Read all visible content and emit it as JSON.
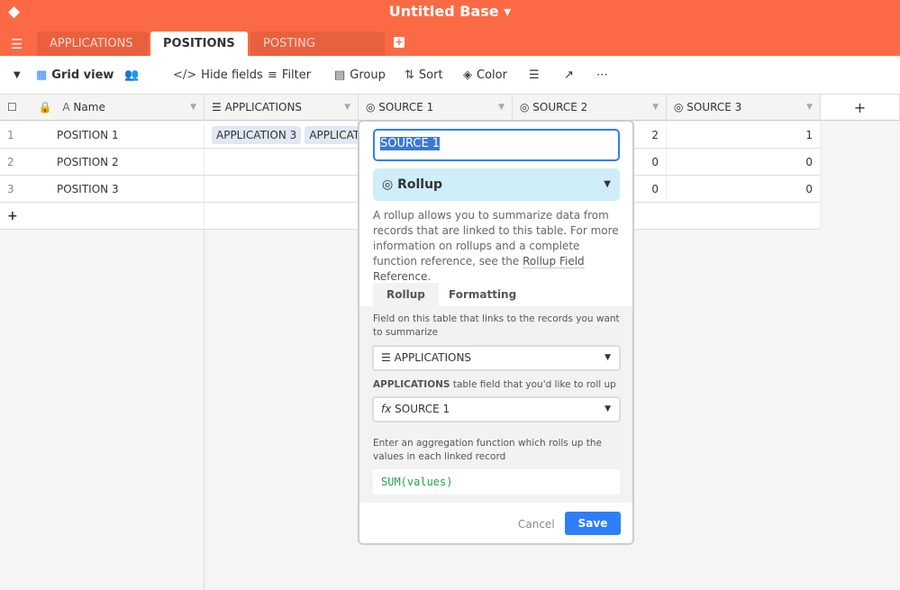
{
  "app": {
    "title": "Untitled Base ▾"
  },
  "tabs": [
    {
      "label": "APPLICATIONS"
    },
    {
      "label": "POSITIONS ▾"
    },
    {
      "label": "POSTING SOURCES"
    }
  ],
  "toolbar": {
    "view": "Grid view",
    "hide_fields": "Hide fields",
    "filter": "Filter",
    "group": "Group",
    "sort": "Sort",
    "color": "Color"
  },
  "columns": [
    {
      "label": "Name"
    },
    {
      "label": "APPLICATIONS"
    },
    {
      "label": "SOURCE 1"
    },
    {
      "label": "SOURCE 2"
    },
    {
      "label": "SOURCE 3"
    }
  ],
  "rows": [
    {
      "num": "1",
      "name": "POSITION 1",
      "apps": [
        "APPLICATION 3",
        "APPLICATION"
      ],
      "s1": "",
      "s2": "2",
      "s3": "1"
    },
    {
      "num": "2",
      "name": "POSITION 2",
      "apps": [],
      "s1": "",
      "s2": "0",
      "s3": "0"
    },
    {
      "num": "3",
      "name": "POSITION 3",
      "apps": [],
      "s1": "",
      "s2": "0",
      "s3": "0"
    }
  ],
  "popup": {
    "field_name": "SOURCE 1",
    "type": "Rollup",
    "desc": "A rollup allows you to summarize data from records that are linked to this table. For more information on rollups and a complete function reference, see the ",
    "desc_link": "Rollup Field Reference",
    "tabs": [
      "Rollup",
      "Formatting"
    ],
    "link_label": "Field on this table that links to the records you want to summarize",
    "link_value": "APPLICATIONS",
    "rollup_label_bold": "APPLICATIONS",
    "rollup_label": " table field that you'd like to roll up",
    "rollup_value": "SOURCE 1",
    "agg_label": "Enter an aggregation function which rolls up the values in each linked record",
    "formula": "SUM(values)",
    "cancel": "Cancel",
    "save": "Save"
  },
  "colors": {
    "brand": "#fc6a45",
    "primary": "#2d7ff9",
    "rollup_bg": "#cfeefa"
  }
}
